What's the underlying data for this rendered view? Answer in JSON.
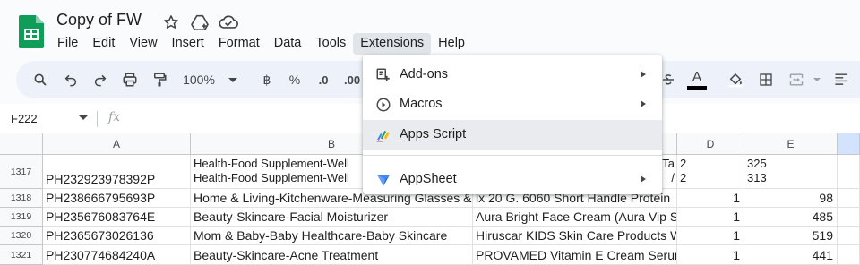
{
  "app": {
    "doc_title": "Copy of FW",
    "icons": [
      "star-icon",
      "move-to-drive-icon",
      "cloud-status-icon"
    ]
  },
  "menubar": {
    "items": [
      "File",
      "Edit",
      "View",
      "Insert",
      "Format",
      "Data",
      "Tools",
      "Extensions",
      "Help"
    ],
    "active": "Extensions"
  },
  "toolbar": {
    "zoom": "100%",
    "currency_symbol": "฿",
    "percent_symbol": "%",
    "decrease_decimal": ".0",
    "increase_decimal": ".00",
    "text_color_letter": "A",
    "colors": {
      "text_color_bar": "#000000",
      "toolbar_bg": "#edf2fa"
    }
  },
  "formula_bar": {
    "name_box": "F222",
    "fx": "fx"
  },
  "grid": {
    "columns": [
      "A",
      "B",
      "C",
      "D",
      "E"
    ],
    "selected_column": "F",
    "rows": [
      {
        "num": "1317",
        "a": "PH232923978392P",
        "b": [
          "Health-Food Supplement-Well",
          "Health-Food Supplement-Well"
        ],
        "c": [
          "Ta",
          "/"
        ],
        "d": [
          "2",
          "2"
        ],
        "e": [
          "325",
          "313"
        ]
      },
      {
        "num": "1318",
        "a": "PH238666795693P",
        "b": "Home & Living-Kitchenware-Measuring Glasses &",
        "c": "lx 20 G. 6060 Short Handle Protein",
        "d": "1",
        "e": "98"
      },
      {
        "num": "1319",
        "a": "PH235676083764E",
        "b": "Beauty-Skincare-Facial Moisturizer",
        "c": "Aura Bright Face Cream (Aura Vip S",
        "d": "1",
        "e": "485"
      },
      {
        "num": "1320",
        "a": "PH2365673026136",
        "b": "Mom & Baby-Baby Healthcare-Baby Skincare",
        "c": "Hiruscar KIDS Skin Care Products W",
        "d": "1",
        "e": "519"
      },
      {
        "num": "1321",
        "a": "PH230774684240A",
        "b": "Beauty-Skincare-Acne Treatment",
        "c": "PROVAMED Vitamin E Cream Serum",
        "d": "1",
        "e": "441"
      }
    ]
  },
  "extensions_menu": {
    "items": [
      {
        "label": "Add-ons",
        "icon": "add-ons-icon",
        "submenu": true
      },
      {
        "label": "Macros",
        "icon": "macros-icon",
        "submenu": true
      },
      {
        "label": "Apps Script",
        "icon": "apps-script-icon",
        "submenu": false,
        "hovered": true
      },
      {
        "label": "AppSheet",
        "icon": "appsheet-icon",
        "submenu": true
      }
    ]
  }
}
